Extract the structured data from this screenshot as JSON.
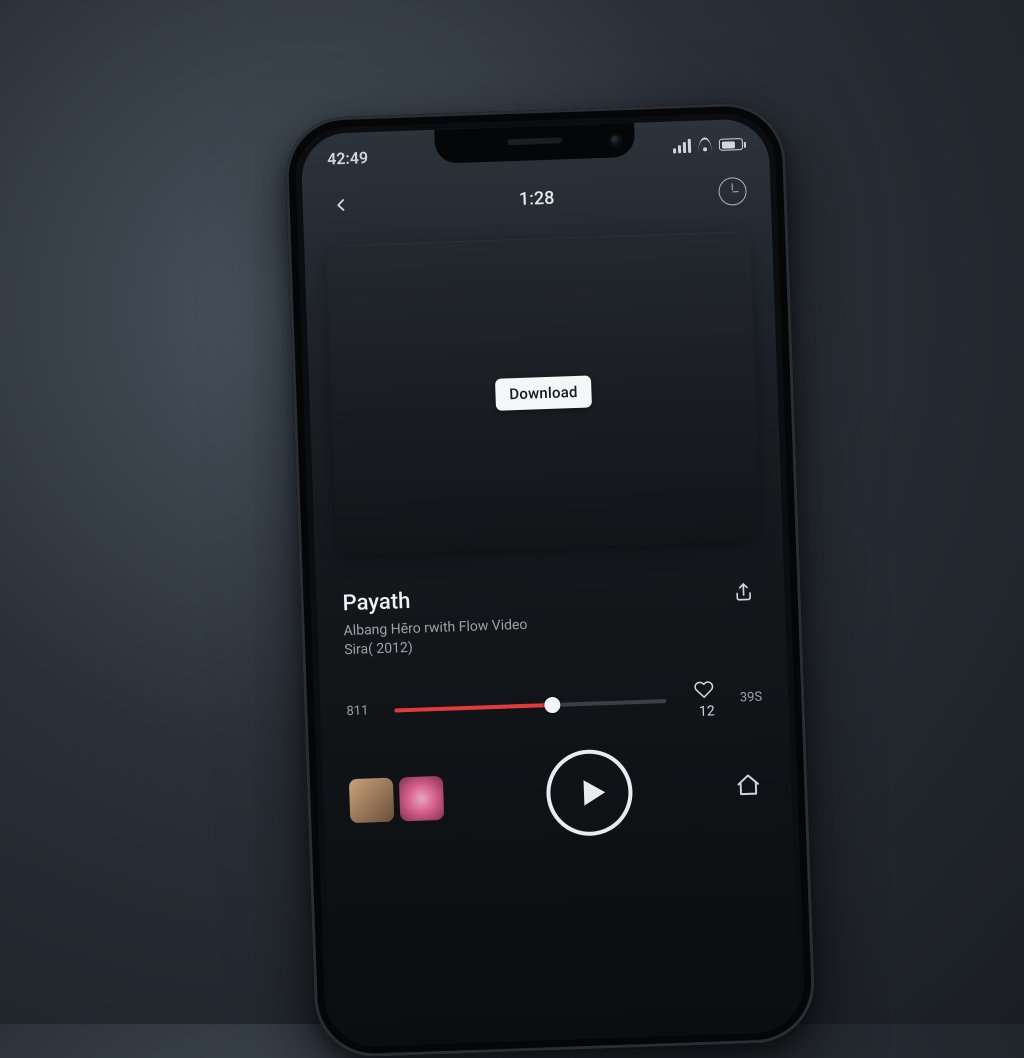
{
  "statusbar": {
    "time": "42:49"
  },
  "header": {
    "title": "1:28"
  },
  "card": {
    "download_label": "Download"
  },
  "track": {
    "title": "Payath",
    "subtitle_line1": "Albang Hēro rwith Flow Video",
    "subtitle_line2": "Sira( 2012)"
  },
  "progress": {
    "elapsed": "811",
    "total": "39S",
    "like_count": "12"
  }
}
